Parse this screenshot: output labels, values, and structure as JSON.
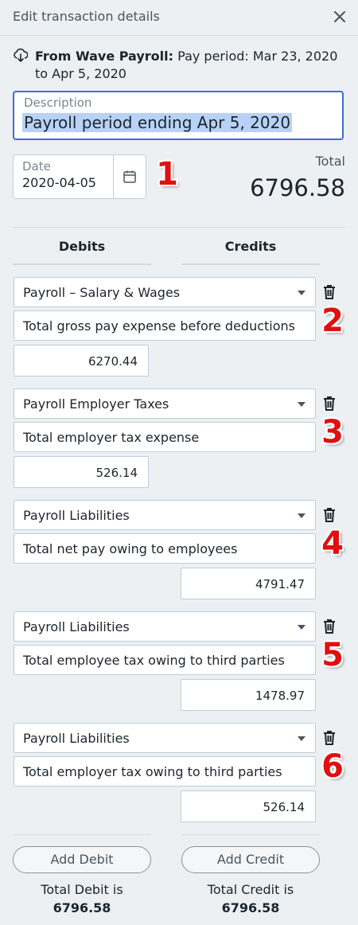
{
  "header": {
    "title": "Edit transaction details"
  },
  "source": {
    "label": "From Wave Payroll:",
    "text": "Pay period: Mar 23, 2020 to Apr 5, 2020"
  },
  "description": {
    "label": "Description",
    "value": "Payroll period ending Apr 5, 2020"
  },
  "date": {
    "label": "Date",
    "value": "2020-04-05"
  },
  "total": {
    "label": "Total",
    "value": "6796.58"
  },
  "columns": {
    "debits": "Debits",
    "credits": "Credits"
  },
  "entries": [
    {
      "account": "Payroll – Salary & Wages",
      "description": "Total gross pay expense before deductions",
      "amount": "6270.44",
      "side": "debit",
      "marker": "2"
    },
    {
      "account": "Payroll Employer Taxes",
      "description": "Total employer tax expense",
      "amount": "526.14",
      "side": "debit",
      "marker": "3"
    },
    {
      "account": "Payroll Liabilities",
      "description": "Total net pay owing to employees",
      "amount": "4791.47",
      "side": "credit",
      "marker": "4"
    },
    {
      "account": "Payroll Liabilities",
      "description": "Total employee tax owing to third parties",
      "amount": "1478.97",
      "side": "credit",
      "marker": "5"
    },
    {
      "account": "Payroll Liabilities",
      "description": "Total employer tax owing to third parties",
      "amount": "526.14",
      "side": "credit",
      "marker": "6"
    }
  ],
  "markers": {
    "date": "1"
  },
  "footer": {
    "add_debit": "Add Debit",
    "add_credit": "Add Credit",
    "total_debit_label": "Total Debit is",
    "total_debit_value": "6796.58",
    "total_credit_label": "Total Credit is",
    "total_credit_value": "6796.58"
  },
  "colors": {
    "accent": "#3b6fdb",
    "marker": "#e01010",
    "selection": "#b7d2f6"
  }
}
